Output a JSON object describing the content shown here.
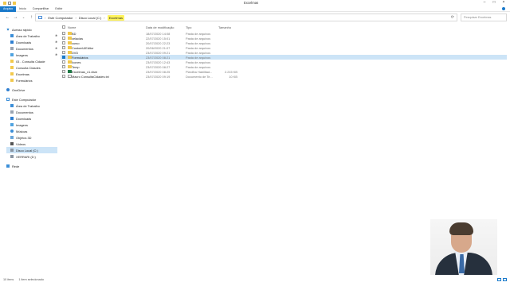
{
  "window": {
    "title": "Excelmas"
  },
  "ribbon": {
    "tabs": [
      "Arquivo",
      "Início",
      "Compartilhar",
      "Exibir"
    ]
  },
  "address": {
    "crumbs": [
      "Este Computador",
      "Disco Local (C:)",
      "Excelmas"
    ],
    "search_placeholder": "Pesquisar Excelmas"
  },
  "nav_pane": {
    "quick_access": "Acesso rápido",
    "quick_items": [
      "Área de Trabalho",
      "Downloads",
      "Documentos",
      "Imagens",
      "03 - Consulta Cidade",
      "Consulta Cidades",
      "Excelmas",
      "Formulários"
    ],
    "onedrive": "OneDrive",
    "this_pc": "Este Computador",
    "pc_items": [
      "Área de Trabalho",
      "Documentos",
      "Downloads",
      "Imagens",
      "Músicas",
      "Objetos 3D",
      "Vídeos",
      "Disco Local (C:)",
      "XERRARI (D:)"
    ],
    "network": "Rede"
  },
  "columns": {
    "name": "Nome",
    "date": "Data de modificação",
    "type": "Tipo",
    "size": "Tamanho"
  },
  "files": [
    {
      "name": "BD",
      "date": "18/07/2020 14:08",
      "type": "Pasta de arquivos",
      "size": "",
      "kind": "folder"
    },
    {
      "name": "celacias",
      "date": "22/07/2020 15:01",
      "type": "Pasta de arquivos",
      "size": "",
      "kind": "folder"
    },
    {
      "name": "curso",
      "date": "20/07/2020 22:23",
      "type": "Pasta de arquivos",
      "size": "",
      "kind": "folder"
    },
    {
      "name": "CustomUIEditor",
      "date": "20/06/2020 21:07",
      "type": "Pasta de arquivos",
      "size": "",
      "kind": "folder"
    },
    {
      "name": "DVD",
      "date": "23/07/2020 09:21",
      "type": "Pasta de arquivos",
      "size": "",
      "kind": "folder"
    },
    {
      "name": "Formulários",
      "date": "23/07/2020 08:21",
      "type": "Pasta de arquivos",
      "size": "",
      "kind": "folder"
    },
    {
      "name": "Ícones",
      "date": "23/07/2020 12:43",
      "type": "Pasta de arquivos",
      "size": "",
      "kind": "folder"
    },
    {
      "name": "Temp",
      "date": "23/07/2020 08:27",
      "type": "Pasta de arquivos",
      "size": "",
      "kind": "folder"
    },
    {
      "name": "Excelmas_v1.xlsm",
      "date": "23/07/2020 08:25",
      "type": "Planilha Habilitad...",
      "size": "2.215 KB",
      "kind": "excel"
    },
    {
      "name": "Macro ConsultaCidades.txt",
      "date": "23/07/2020 09:19",
      "type": "Documento de Te...",
      "size": "10 KB",
      "kind": "text"
    }
  ],
  "status": {
    "count": "10 itens",
    "selected": "1 item selecionado"
  },
  "colors": {
    "accent": "#1979ca",
    "selection": "#cce4f7",
    "folder": "#f2c94c",
    "highlight": "#fff35a"
  }
}
